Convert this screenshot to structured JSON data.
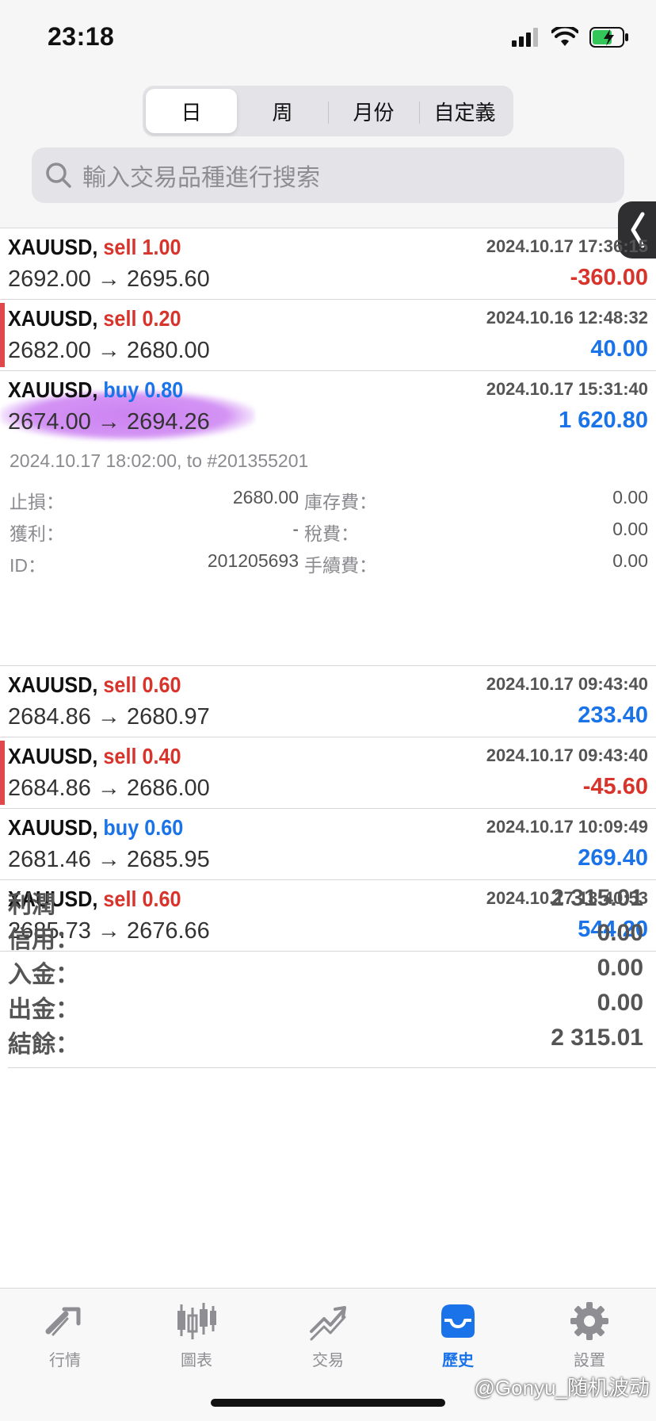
{
  "status_bar": {
    "time": "23:18"
  },
  "period_tabs": {
    "items": [
      "日",
      "周",
      "月份",
      "自定義"
    ],
    "active": "日"
  },
  "search": {
    "placeholder": "輸入交易品種進行搜索"
  },
  "trades": [
    {
      "symbol": "XAUUSD,",
      "side": "sell",
      "volume": "1.00",
      "datetime": "2024.10.17 17:36:15",
      "prices": "2692.00 → 2695.60",
      "profit": "-360.00",
      "profit_sign": "neg",
      "marked": false
    },
    {
      "symbol": "XAUUSD,",
      "side": "sell",
      "volume": "0.20",
      "datetime": "2024.10.16 12:48:32",
      "prices": "2682.00 → 2680.00",
      "profit": "40.00",
      "profit_sign": "pos",
      "marked": true
    },
    {
      "symbol": "XAUUSD,",
      "side": "buy",
      "volume": "0.80",
      "datetime": "2024.10.17 15:31:40",
      "prices": "2674.00 → 2694.26",
      "profit": "1 620.80",
      "profit_sign": "pos",
      "marked": false
    },
    {
      "symbol": "XAUUSD,",
      "side": "sell",
      "volume": "0.60",
      "datetime": "2024.10.17 09:43:40",
      "prices": "2684.86 → 2680.97",
      "profit": "233.40",
      "profit_sign": "pos",
      "marked": false
    },
    {
      "symbol": "XAUUSD,",
      "side": "sell",
      "volume": "0.40",
      "datetime": "2024.10.17 09:43:40",
      "prices": "2684.86 → 2686.00",
      "profit": "-45.60",
      "profit_sign": "neg",
      "marked": true
    },
    {
      "symbol": "XAUUSD,",
      "side": "buy",
      "volume": "0.60",
      "datetime": "2024.10.17 10:09:49",
      "prices": "2681.46 → 2685.95",
      "profit": "269.40",
      "profit_sign": "pos",
      "marked": false
    },
    {
      "symbol": "XAUUSD,",
      "side": "sell",
      "volume": "0.60",
      "datetime": "2024.10.17 13:40:53",
      "prices": "2685.73 → 2676.66",
      "profit": "544.20",
      "profit_sign": "pos",
      "marked": false
    }
  ],
  "detail": {
    "close_info": "2024.10.17 18:02:00, to #201355201",
    "rows": [
      {
        "left_key": "止損：",
        "left_val": "2680.00",
        "right_key": "庫存費：",
        "right_val": "0.00"
      },
      {
        "left_key": "獲利：",
        "left_val": "-",
        "right_key": "稅費：",
        "right_val": "0.00"
      },
      {
        "left_key": "ID：",
        "left_val": "201205693",
        "right_key": "手續費：",
        "right_val": "0.00"
      }
    ]
  },
  "summary": [
    {
      "key": "利潤",
      "value": "2 315.01"
    },
    {
      "key": "信用：",
      "value": "0.00"
    },
    {
      "key": "入金：",
      "value": "0.00"
    },
    {
      "key": "出金：",
      "value": "0.00"
    },
    {
      "key": "結餘：",
      "value": "2 315.01"
    }
  ],
  "tabbar": {
    "items": [
      {
        "label": "行情",
        "icon": "quotes-icon"
      },
      {
        "label": "圖表",
        "icon": "chart-icon"
      },
      {
        "label": "交易",
        "icon": "trade-icon"
      },
      {
        "label": "歷史",
        "icon": "history-icon"
      },
      {
        "label": "設置",
        "icon": "settings-icon"
      }
    ],
    "active": "歷史"
  },
  "watermark": "@Gonyu_随机波动",
  "colors": {
    "sell": "#d9342b",
    "buy": "#1a73e8",
    "accent": "#1a73e8",
    "highlight": "#c46ef0"
  }
}
